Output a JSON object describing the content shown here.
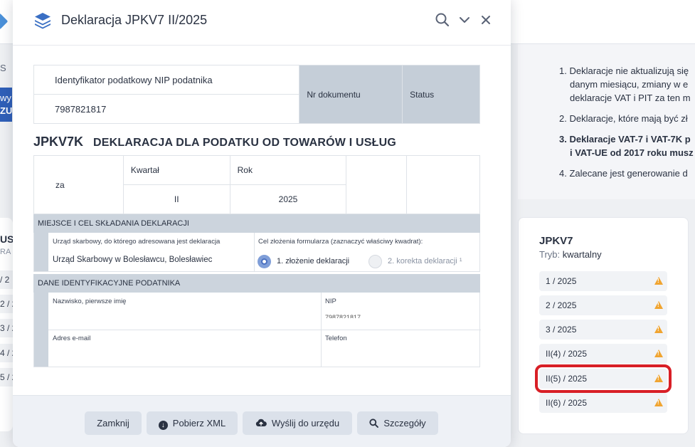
{
  "modal": {
    "title": "Deklaracja JPKV7 II/2025"
  },
  "doc": {
    "nip_label": "Identyfikator podatkowy NIP podatnika",
    "nip_value": "7987821817",
    "nr_dokumentu_label": "Nr dokumentu",
    "status_label": "Status",
    "code": "JPKV7K",
    "description": "DEKLARACJA DLA PODATKU OD TOWARÓW I USŁUG",
    "za_label": "za",
    "kwartal_label": "Kwartał",
    "kwartal_value": "II",
    "rok_label": "Rok",
    "rok_value": "2025",
    "section1_title": "MIEJSCE I CEL SKŁADANIA DEKLARACJI",
    "urzad_label": "Urząd skarbowy, do którego adresowana jest deklaracja",
    "urzad_value": "Urząd Skarbowy w Bolesławcu, Bolesławiec",
    "cel_label": "Cel złożenia formularza (zaznaczyć właściwy kwadrat):",
    "cel_option1": "1. złożenie deklaracji",
    "cel_option2": "2. korekta deklaracji ¹",
    "section2_title": "DANE IDENTYFIKACYJNE PODATNIKA",
    "nazwisko_label": "Nazwisko, pierwsze imię",
    "nip2_label": "NIP",
    "nip2_value": "7987821817",
    "email_label": "Adres e-mail",
    "telefon_label": "Telefon"
  },
  "footer": {
    "close_label": "Zamknij",
    "download_label": "Pobierz XML",
    "send_label": "Wyślij do urzędu",
    "details_label": "Szczegóły"
  },
  "background": {
    "left_s": "S",
    "left_btn_line1": "wy",
    "left_btn_line2": "ZU",
    "left_us": "US",
    "left_ra": "RA",
    "left_rows": [
      "/ 2",
      "2 / 2",
      "3 / 2",
      "4 / 2",
      "5 / 2"
    ],
    "info_items": [
      "1. Deklaracje nie aktualizują się",
      "danym miesiącu, zmiany w e",
      "deklaracje VAT i PIT za ten m",
      "2. Deklaracje, które mają być zł",
      "3. Deklaracje VAT-7 i VAT-7K p",
      "i VAT-UE od 2017 roku musz",
      "4. Zalecane jest generowanie d"
    ]
  },
  "side": {
    "title": "JPKV7",
    "mode_label": "Tryb:",
    "mode_value": "kwartalny",
    "items": [
      "1 / 2025",
      "2 / 2025",
      "3 / 2025",
      "II(4) / 2025",
      "II(5) / 2025",
      "II(6) / 2025"
    ],
    "highlighted_index": 4
  },
  "colors": {
    "accent": "#2f5fb8",
    "warning": "#f0a430",
    "highlight": "#d81f26",
    "section_gray": "#ccd4dd"
  }
}
